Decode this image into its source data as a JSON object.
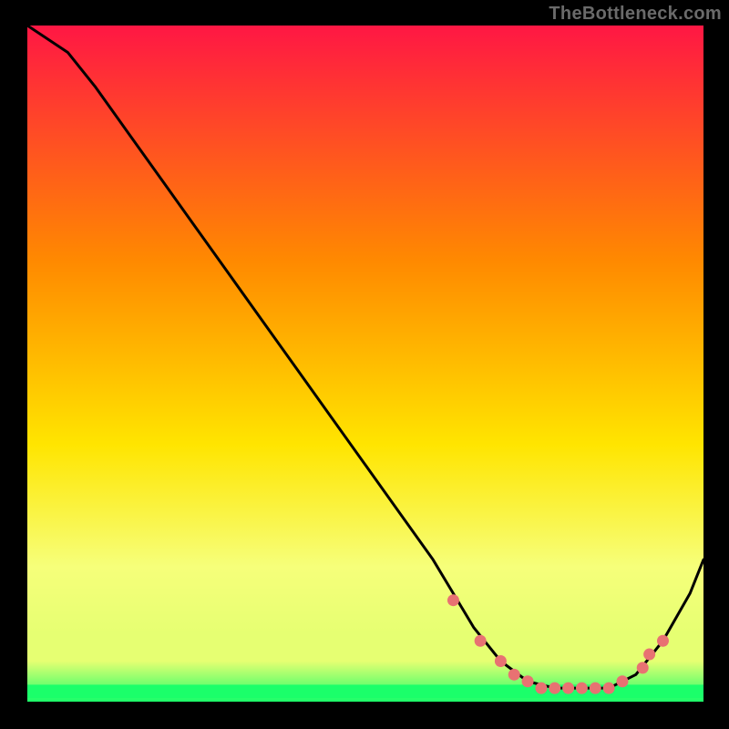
{
  "watermark": "TheBottleneck.com",
  "colors": {
    "bg": "#000000",
    "gradient_top": "#ff1744",
    "gradient_mid1": "#ff8a00",
    "gradient_mid2": "#ffe500",
    "gradient_low": "#f6ff7a",
    "gradient_band_top": "#e6ff72",
    "gradient_band_bottom": "#1bff6a",
    "line": "#000000",
    "marker": "#e87272"
  },
  "chart_data": {
    "type": "line",
    "title": "",
    "xlabel": "",
    "ylabel": "",
    "xlim": [
      0,
      100
    ],
    "ylim": [
      0,
      100
    ],
    "series": [
      {
        "name": "bottleneck-curve",
        "x": [
          0,
          6,
          10,
          15,
          20,
          25,
          30,
          35,
          40,
          45,
          50,
          55,
          60,
          63,
          66,
          70,
          74,
          78,
          82,
          86,
          90,
          94,
          98,
          100
        ],
        "y": [
          100,
          96,
          91,
          84,
          77,
          70,
          63,
          56,
          49,
          42,
          35,
          28,
          21,
          16,
          11,
          6,
          3,
          2,
          2,
          2,
          4,
          9,
          16,
          21
        ]
      }
    ],
    "markers": {
      "name": "highlight-points",
      "x": [
        63,
        67,
        70,
        72,
        74,
        76,
        78,
        80,
        82,
        84,
        86,
        88,
        91,
        92,
        94
      ],
      "y": [
        15,
        9,
        6,
        4,
        3,
        2,
        2,
        2,
        2,
        2,
        2,
        3,
        5,
        7,
        9
      ]
    },
    "gradient_stops_pct": [
      0,
      35,
      62,
      80,
      90,
      94,
      100
    ],
    "green_band_top_pct": 94
  }
}
